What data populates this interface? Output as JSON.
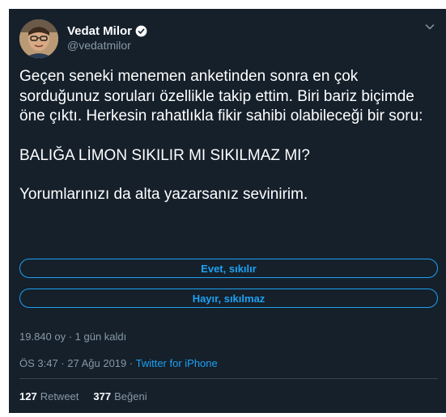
{
  "author": {
    "display_name": "Vedat Milor",
    "handle": "@vedatmilor",
    "verified": true
  },
  "tweet": {
    "paragraphs": [
      "Geçen seneki menemen anketinden sonra en çok sorduğunuz soruları özellikle takip ettim. Biri bariz biçimde öne çıktı. Herkesin rahatlıkla fikir sahibi olabileceği bir soru:",
      "BALIĞA LİMON SIKILIR MI SIKILMAZ MI?",
      "Yorumlarınızı da alta yazarsanız sevinirim."
    ]
  },
  "poll": {
    "options": [
      {
        "label": "Evet, sıkılır"
      },
      {
        "label": "Hayır, sıkılmaz"
      }
    ],
    "meta": "19.840 oy · 1 gün kaldı"
  },
  "timestamp": {
    "time_date": "ÖS 3:47 · 27 Ağu 2019 · ",
    "source": "Twitter for iPhone"
  },
  "stats": {
    "retweets_count": "127",
    "retweets_label": "Retweet",
    "likes_count": "377",
    "likes_label": "Beğeni"
  },
  "colors": {
    "background": "#15202b",
    "accent": "#1da1f2",
    "secondary_text": "#8899a6",
    "divider": "#38444d"
  },
  "icons": {
    "verified": "verified-badge-icon",
    "caret": "chevron-down-icon"
  }
}
